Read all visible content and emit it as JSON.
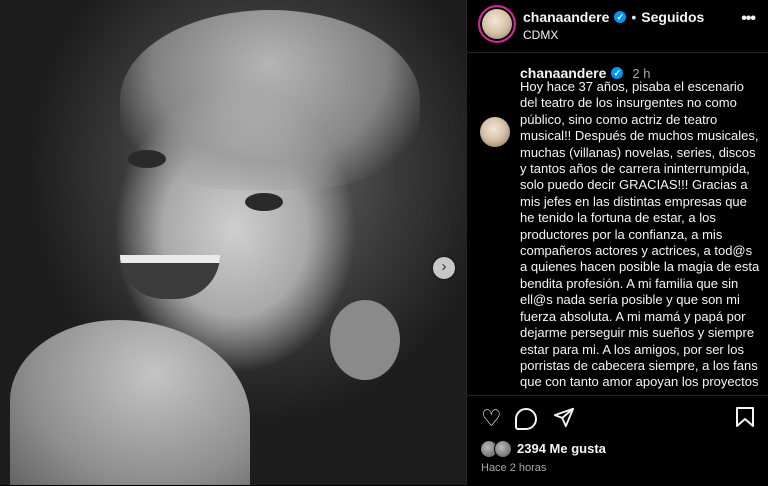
{
  "post": {
    "username": "chanaandere",
    "follow_status": "Seguidos",
    "location": "CDMX",
    "time_ago": "2 h",
    "caption": "Hoy hace 37 años, pisaba el escenario del teatro de los insurgentes no como público, sino como actriz de teatro musical!! Después de muchos musicales, muchas (villanas) novelas, series, discos y tantos años de carrera ininterrumpida, solo puedo decir GRACIAS!!! Gracias a mis jefes en las distintas empresas que he tenido la fortuna de estar, a los productores por la confianza, a mis compañeros actores y actrices, a tod@s a quienes hacen posible la magia de esta bendita profesión. A mi familia que sin ell@s nada sería posible y que son mi fuerza absoluta. A mi mamá y papá por dejarme perseguir mis sueños y siempre estar para mi. A los amigos, por ser los porristas de cabecera siempre, a los fans que con tanto amor apoyan los proyectos",
    "likes_count": "2394",
    "likes_label": "Me gusta",
    "posted_ago": "Hace 2 horas"
  },
  "icons": {
    "more": "more-options-icon",
    "next": "chevron-right-icon",
    "like": "heart-icon",
    "comment": "comment-icon",
    "share": "share-icon",
    "save": "bookmark-icon",
    "verified": "verified-badge-icon"
  },
  "colors": {
    "background": "#000000",
    "text": "#f5f5f5",
    "secondary_text": "#a8a8a8",
    "verified": "#0095f6",
    "story_ring": "#d6249f"
  }
}
